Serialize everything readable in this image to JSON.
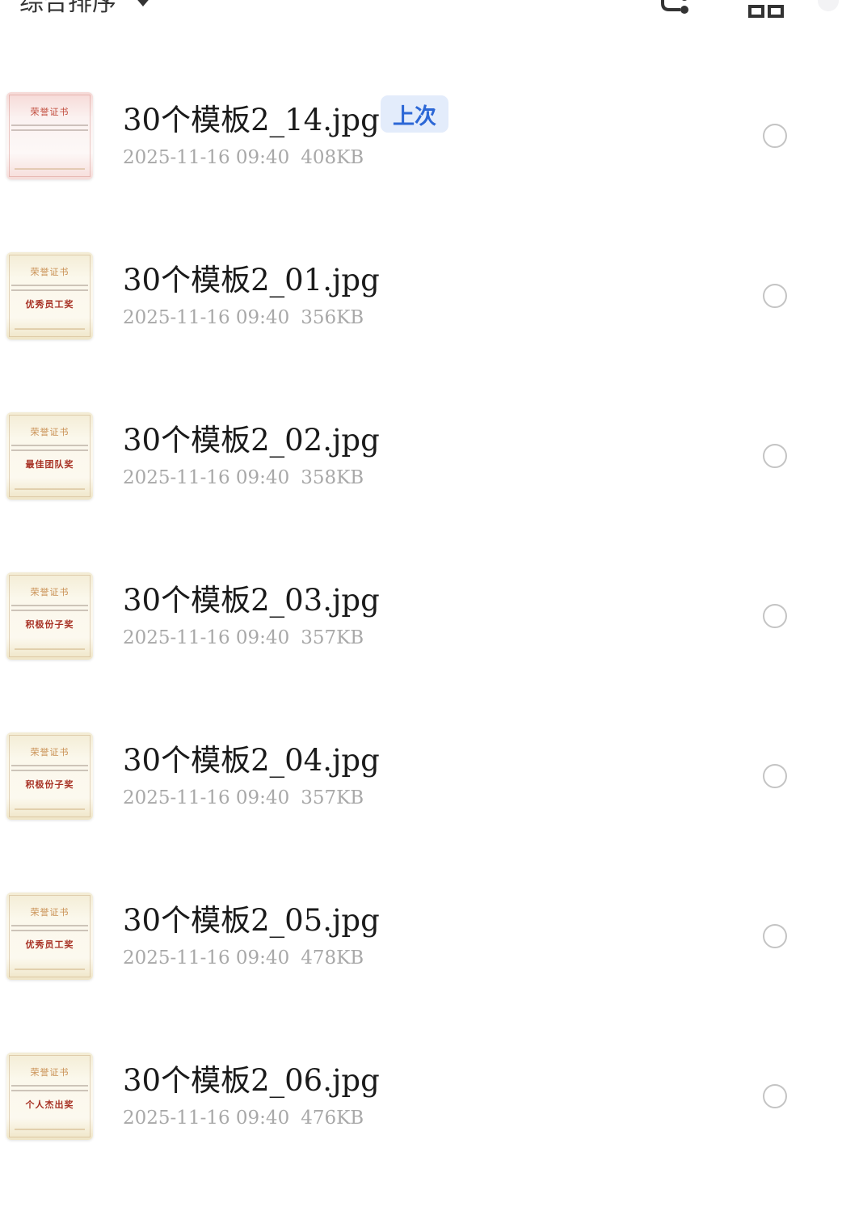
{
  "toolbar": {
    "sort_label": "综合排序",
    "icons": [
      "chevron-down-icon",
      "tree-view-icon",
      "grid-view-icon"
    ]
  },
  "files": [
    {
      "name": "30个模板2_14.jpg",
      "date": "2025-11-16 09:40",
      "size": "408KB",
      "badge": "上次",
      "thumb_title": "荣誉证书",
      "thumb_award": "",
      "thumb_style": "red"
    },
    {
      "name": "30个模板2_01.jpg",
      "date": "2025-11-16 09:40",
      "size": "356KB",
      "badge": "",
      "thumb_title": "荣誉证书",
      "thumb_award": "优秀员工奖",
      "thumb_style": "gold"
    },
    {
      "name": "30个模板2_02.jpg",
      "date": "2025-11-16 09:40",
      "size": "358KB",
      "badge": "",
      "thumb_title": "荣誉证书",
      "thumb_award": "最佳团队奖",
      "thumb_style": "gold"
    },
    {
      "name": "30个模板2_03.jpg",
      "date": "2025-11-16 09:40",
      "size": "357KB",
      "badge": "",
      "thumb_title": "荣誉证书",
      "thumb_award": "积极份子奖",
      "thumb_style": "gold"
    },
    {
      "name": "30个模板2_04.jpg",
      "date": "2025-11-16 09:40",
      "size": "357KB",
      "badge": "",
      "thumb_title": "荣誉证书",
      "thumb_award": "积极份子奖",
      "thumb_style": "gold"
    },
    {
      "name": "30个模板2_05.jpg",
      "date": "2025-11-16 09:40",
      "size": "478KB",
      "badge": "",
      "thumb_title": "荣誉证书",
      "thumb_award": "优秀员工奖",
      "thumb_style": "gold"
    },
    {
      "name": "30个模板2_06.jpg",
      "date": "2025-11-16 09:40",
      "size": "476KB",
      "badge": "",
      "thumb_title": "荣誉证书",
      "thumb_award": "个人杰出奖",
      "thumb_style": "gold"
    }
  ],
  "colors": {
    "badge_bg": "#e3ecfb",
    "badge_text": "#2c67d6",
    "meta_text": "#a8a8a8",
    "radio_border": "#c4c4c4"
  }
}
